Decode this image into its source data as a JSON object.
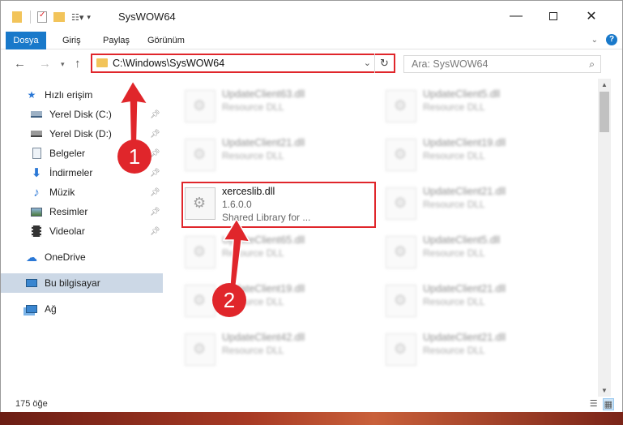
{
  "window": {
    "title": "SysWOW64",
    "controls": [
      "minimize-icon",
      "maximize-icon",
      "close-icon"
    ]
  },
  "ribbon": {
    "tabs": [
      "Dosya",
      "Giriş",
      "Paylaş",
      "Görünüm"
    ],
    "help": "?"
  },
  "nav": {
    "address": "C:\\Windows\\SysWOW64",
    "search_placeholder": "Ara: SysWOW64"
  },
  "sidebar": {
    "quick_access": "Hızlı erişim",
    "items": [
      {
        "label": "Yerel Disk (C:)",
        "icon": "drive-icon",
        "pinned": true
      },
      {
        "label": "Yerel Disk (D:)",
        "icon": "drive-icon",
        "pinned": true
      },
      {
        "label": "Belgeler",
        "icon": "documents-icon",
        "pinned": true
      },
      {
        "label": "İndirmeler",
        "icon": "download-icon",
        "pinned": true
      },
      {
        "label": "Müzik",
        "icon": "music-icon",
        "pinned": true
      },
      {
        "label": "Resimler",
        "icon": "pictures-icon",
        "pinned": true
      },
      {
        "label": "Videolar",
        "icon": "videos-icon",
        "pinned": true
      }
    ],
    "onedrive": "OneDrive",
    "this_pc": "Bu bilgisayar",
    "network": "Ağ"
  },
  "files": {
    "left": [
      {
        "name": "UpdateClient63.dll",
        "desc": "Resource DLL"
      },
      {
        "name": "UpdateClient21.dll",
        "desc": "Resource DLL"
      },
      {
        "name": "xerceslib.dll",
        "desc": "1.6.0.0",
        "extra": "Shared Library for ..."
      },
      {
        "name": "UpdateClient65.dll",
        "desc": "Resource DLL"
      },
      {
        "name": "UpdateClient19.dll",
        "desc": "Resource DLL"
      },
      {
        "name": "UpdateClient42.dll",
        "desc": "Resource DLL"
      }
    ],
    "right": [
      {
        "name": "UpdateClient5.dll",
        "desc": "Resource DLL"
      },
      {
        "name": "UpdateClient19.dll",
        "desc": "Resource DLL"
      },
      {
        "name": "UpdateClient21.dll",
        "desc": "Resource DLL"
      },
      {
        "name": "UpdateClient5.dll",
        "desc": "Resource DLL"
      },
      {
        "name": "UpdateClient21.dll",
        "desc": "Resource DLL"
      },
      {
        "name": "UpdateClient21.dll",
        "desc": "Resource DLL"
      }
    ]
  },
  "status": {
    "count": "175 öğe"
  },
  "annotations": {
    "badge1": "1",
    "badge2": "2",
    "color": "#e0262b"
  }
}
